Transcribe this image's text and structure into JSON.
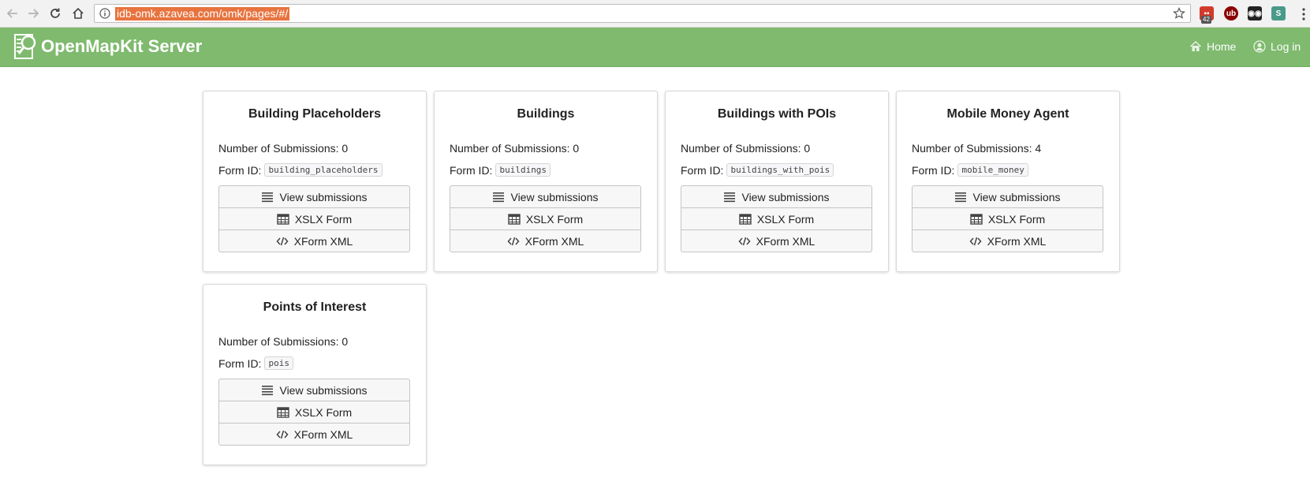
{
  "browser": {
    "url": "idb-omk.azavea.com/omk/pages/#/",
    "extension_badge": "42"
  },
  "navbar": {
    "brand": "OpenMapKit Server",
    "home_label": "Home",
    "login_label": "Log in"
  },
  "labels": {
    "submissions_prefix": "Number of Submissions: ",
    "form_id_prefix": "Form ID:",
    "view_submissions": "View submissions",
    "xslx_form": "XSLX Form",
    "xform_xml": "XForm XML"
  },
  "forms": [
    {
      "title": "Building Placeholders",
      "submissions": "0",
      "form_id": "building_placeholders"
    },
    {
      "title": "Buildings",
      "submissions": "0",
      "form_id": "buildings"
    },
    {
      "title": "Buildings with POIs",
      "submissions": "0",
      "form_id": "buildings_with_pois"
    },
    {
      "title": "Mobile Money Agent",
      "submissions": "4",
      "form_id": "mobile_money"
    },
    {
      "title": "Points of Interest",
      "submissions": "0",
      "form_id": "pois"
    }
  ],
  "colors": {
    "navbar": "#7fba6e",
    "url_highlight": "#e8733e"
  }
}
